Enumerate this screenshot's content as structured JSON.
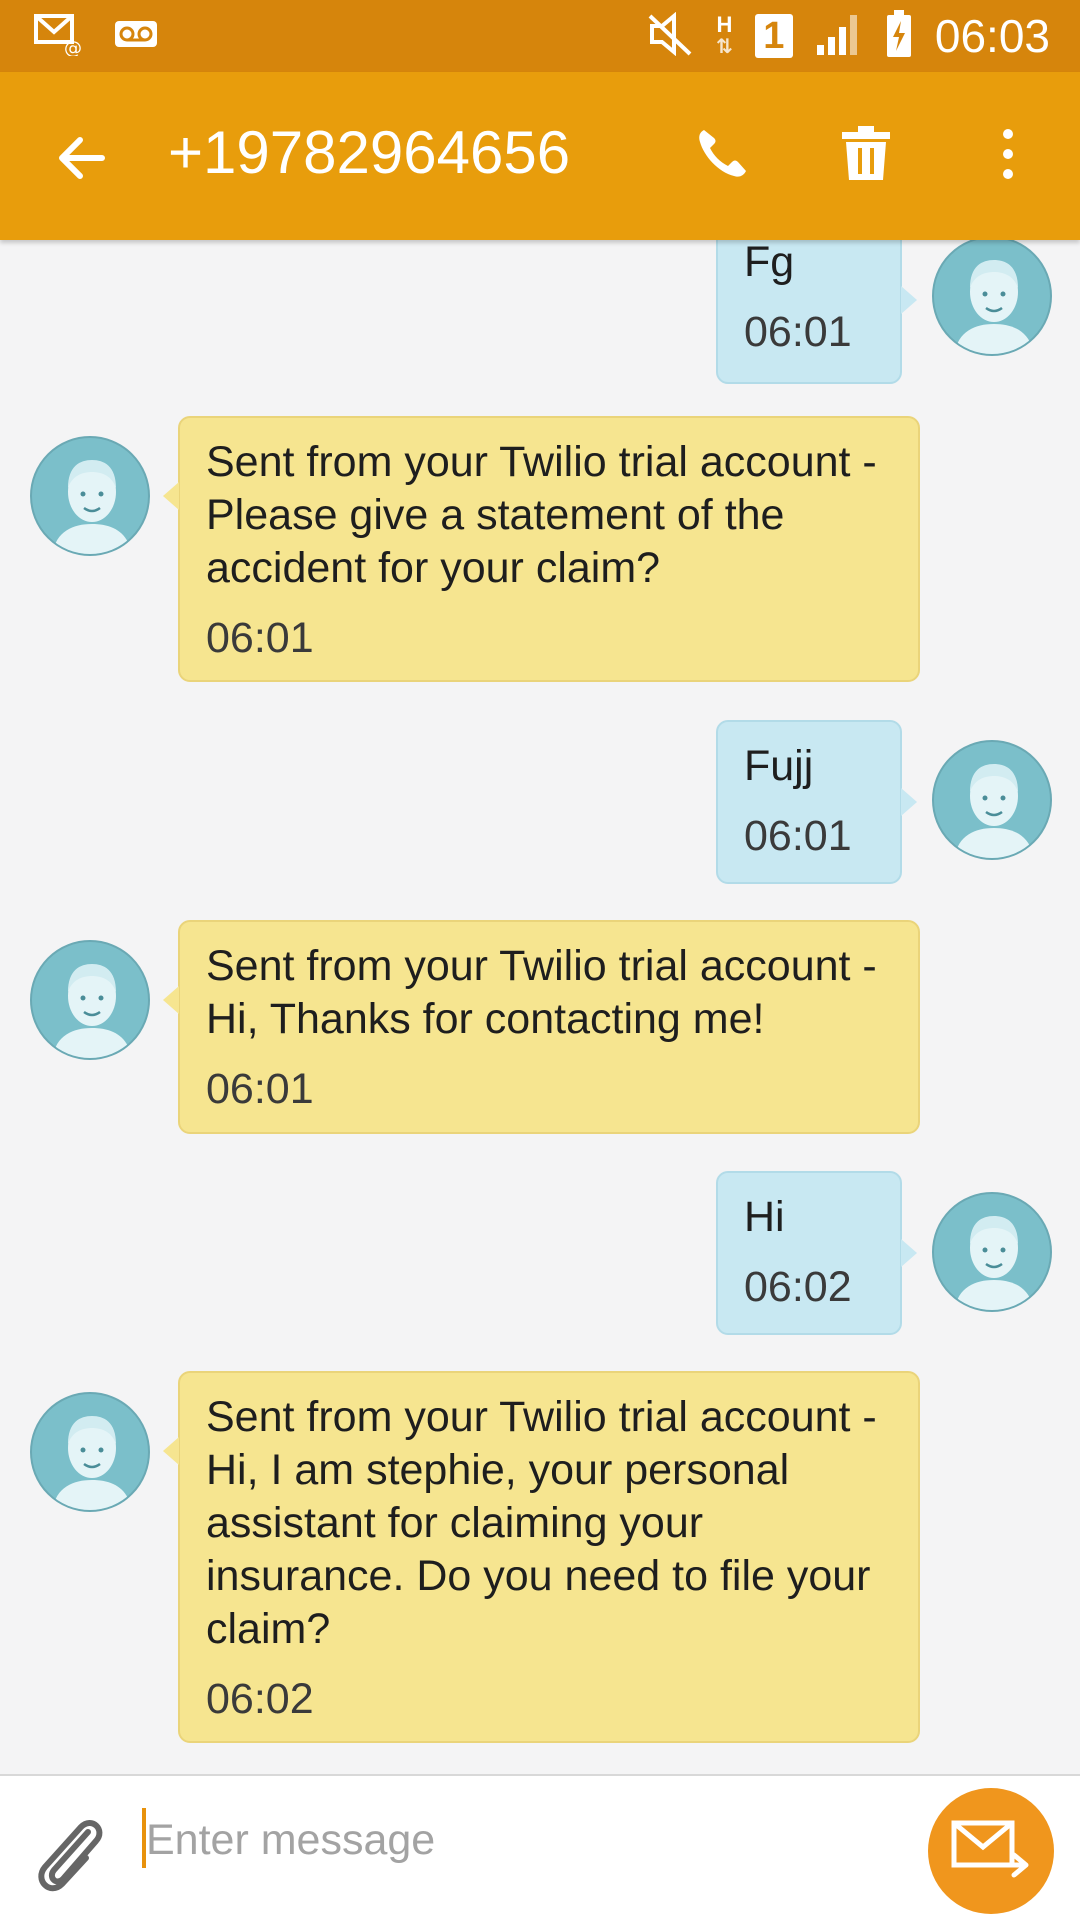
{
  "status_bar": {
    "time": "06:03",
    "sim_slot": "1",
    "network_type": "H",
    "network_arrows": "⇅",
    "icons": [
      "email-notification-icon",
      "voicemail-icon",
      "mute-icon",
      "network-h-icon",
      "sim-1-icon",
      "signal-icon",
      "battery-charging-icon"
    ]
  },
  "header": {
    "contact": "+19782964656",
    "back_icon": "back-arrow-icon",
    "call_icon": "phone-icon",
    "delete_icon": "trash-icon",
    "menu_icon": "more-vert-icon"
  },
  "messages": [
    {
      "direction": "out",
      "text": "Fg",
      "time": "06:01"
    },
    {
      "direction": "in",
      "text": "Sent from your Twilio trial account - Please give a statement of the accident for your claim?",
      "time": "06:01"
    },
    {
      "direction": "out",
      "text": "Fujj",
      "time": "06:01"
    },
    {
      "direction": "in",
      "text": "Sent from your Twilio trial account - Hi, Thanks for contacting me!",
      "time": "06:01"
    },
    {
      "direction": "out",
      "text": "Hi",
      "time": "06:02"
    },
    {
      "direction": "in",
      "text": "Sent from your Twilio trial account - Hi, I am stephie, your personal assistant for claiming your insurance. Do you need to file your claim?",
      "time": "06:02"
    }
  ],
  "composer": {
    "placeholder": "Enter message",
    "value": "",
    "attach_icon": "paperclip-icon",
    "send_icon": "send-message-icon"
  },
  "colors": {
    "status_bar": "#d6850c",
    "app_bar": "#e89d0c",
    "outgoing_bubble": "#c8e8f2",
    "incoming_bubble": "#f6e590",
    "avatar": "#7bbfca",
    "send_button": "#f0961d"
  }
}
